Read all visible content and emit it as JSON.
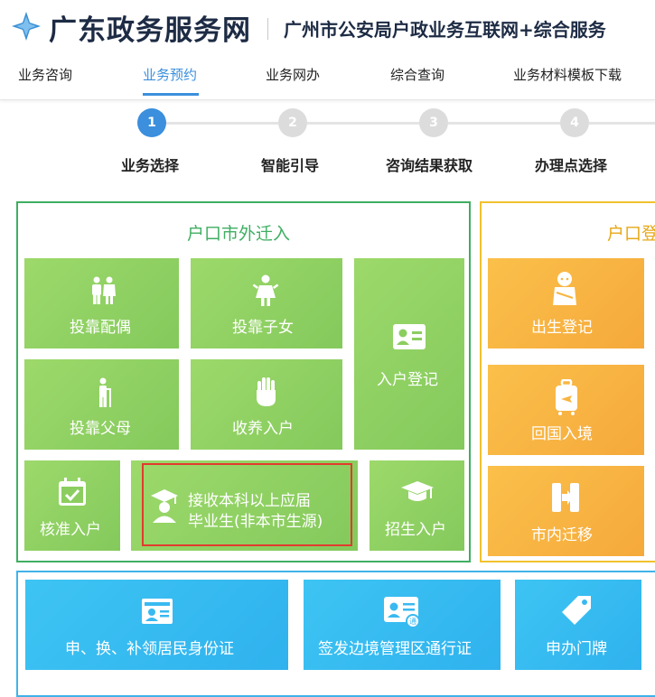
{
  "header": {
    "site_title": "广东政务服务网",
    "sub_title": "广州市公安局户政业务互联网+综合服务"
  },
  "nav": {
    "items": [
      "业务咨询",
      "业务预约",
      "业务网办",
      "综合查询",
      "业务材料模板下载"
    ],
    "active_index": 1
  },
  "steps": [
    {
      "num": "1",
      "label": "业务选择",
      "active": true
    },
    {
      "num": "2",
      "label": "智能引导",
      "active": false
    },
    {
      "num": "3",
      "label": "咨询结果获取",
      "active": false
    },
    {
      "num": "4",
      "label": "办理点选择",
      "active": false
    }
  ],
  "sections": {
    "hukou_out": {
      "title": "户口市外迁入",
      "tiles": {
        "spouse": "投靠配偶",
        "children": "投靠子女",
        "register": "入户登记",
        "parents": "投靠父母",
        "adopt": "收养入户",
        "approved": "核准入户",
        "graduate_line1": "接收本科以上应届",
        "graduate_line2": "毕业生(非本市生源)",
        "enroll": "招生入户"
      }
    },
    "hukou_reg": {
      "title": "户口登",
      "tiles": {
        "birth": "出生登记",
        "return": "回国入境",
        "move": "市内迁移"
      }
    },
    "cert": {
      "tiles": {
        "idcard": "申、换、补领居民身份证",
        "border": "签发边境管理区通行证",
        "doorplate": "申办门牌"
      }
    }
  },
  "colors": {
    "brand_blue": "#3b8fdd",
    "green": "#3fae62",
    "yellow": "#f2c12e",
    "blue": "#41b2e8",
    "highlight": "#e23b2e"
  }
}
